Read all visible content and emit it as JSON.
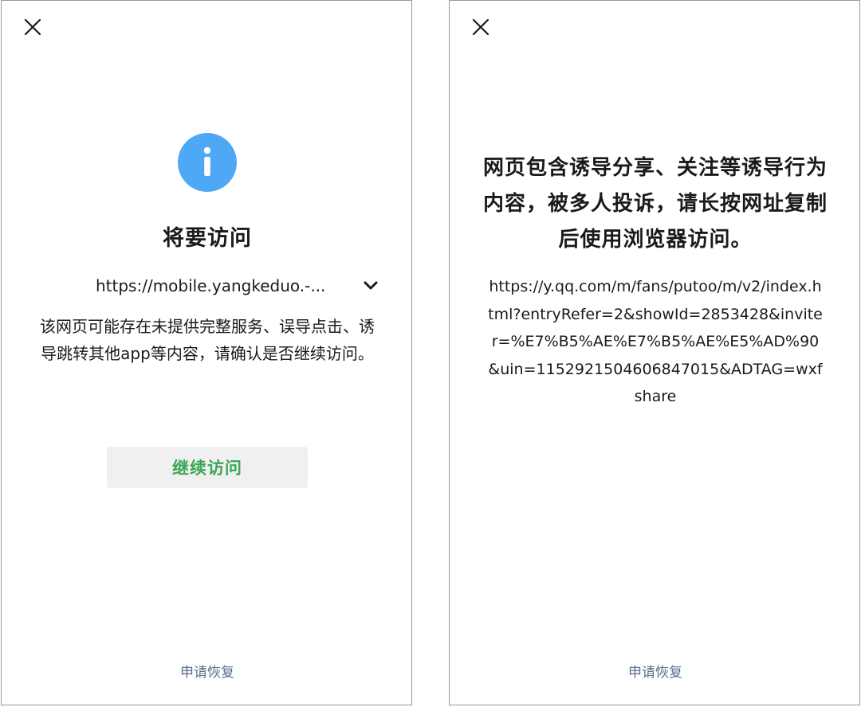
{
  "left_screen": {
    "title": "将要访问",
    "url": "https://mobile.yangkeduo.-...",
    "warning": "该网页可能存在未提供完整服务、误导点击、诱导跳转其他app等内容，请确认是否继续访问。",
    "continue_label": "继续访问",
    "appeal_label": "申请恢复"
  },
  "right_screen": {
    "notice": "网页包含诱导分享、关注等诱导行为内容，被多人投诉，请长按网址复制后使用浏览器访问。",
    "url": "https://y.qq.com/m/fans/putoo/m/v2/index.html?entryRefer=2&showId=2853428&inviter=%E7%B5%AE%E7%B5%AE%E5%AD%90&uin=1152921504606847015&ADTAG=wxfshare",
    "appeal_label": "申请恢复"
  },
  "icons": {
    "close": "close-icon",
    "info": "info-icon",
    "expand": "chevron-down-icon"
  },
  "colors": {
    "info_blue": "#4ea8f5",
    "continue_green": "#3aa655",
    "link_blue": "#5b6c92",
    "button_bg": "#f0f0f0"
  }
}
